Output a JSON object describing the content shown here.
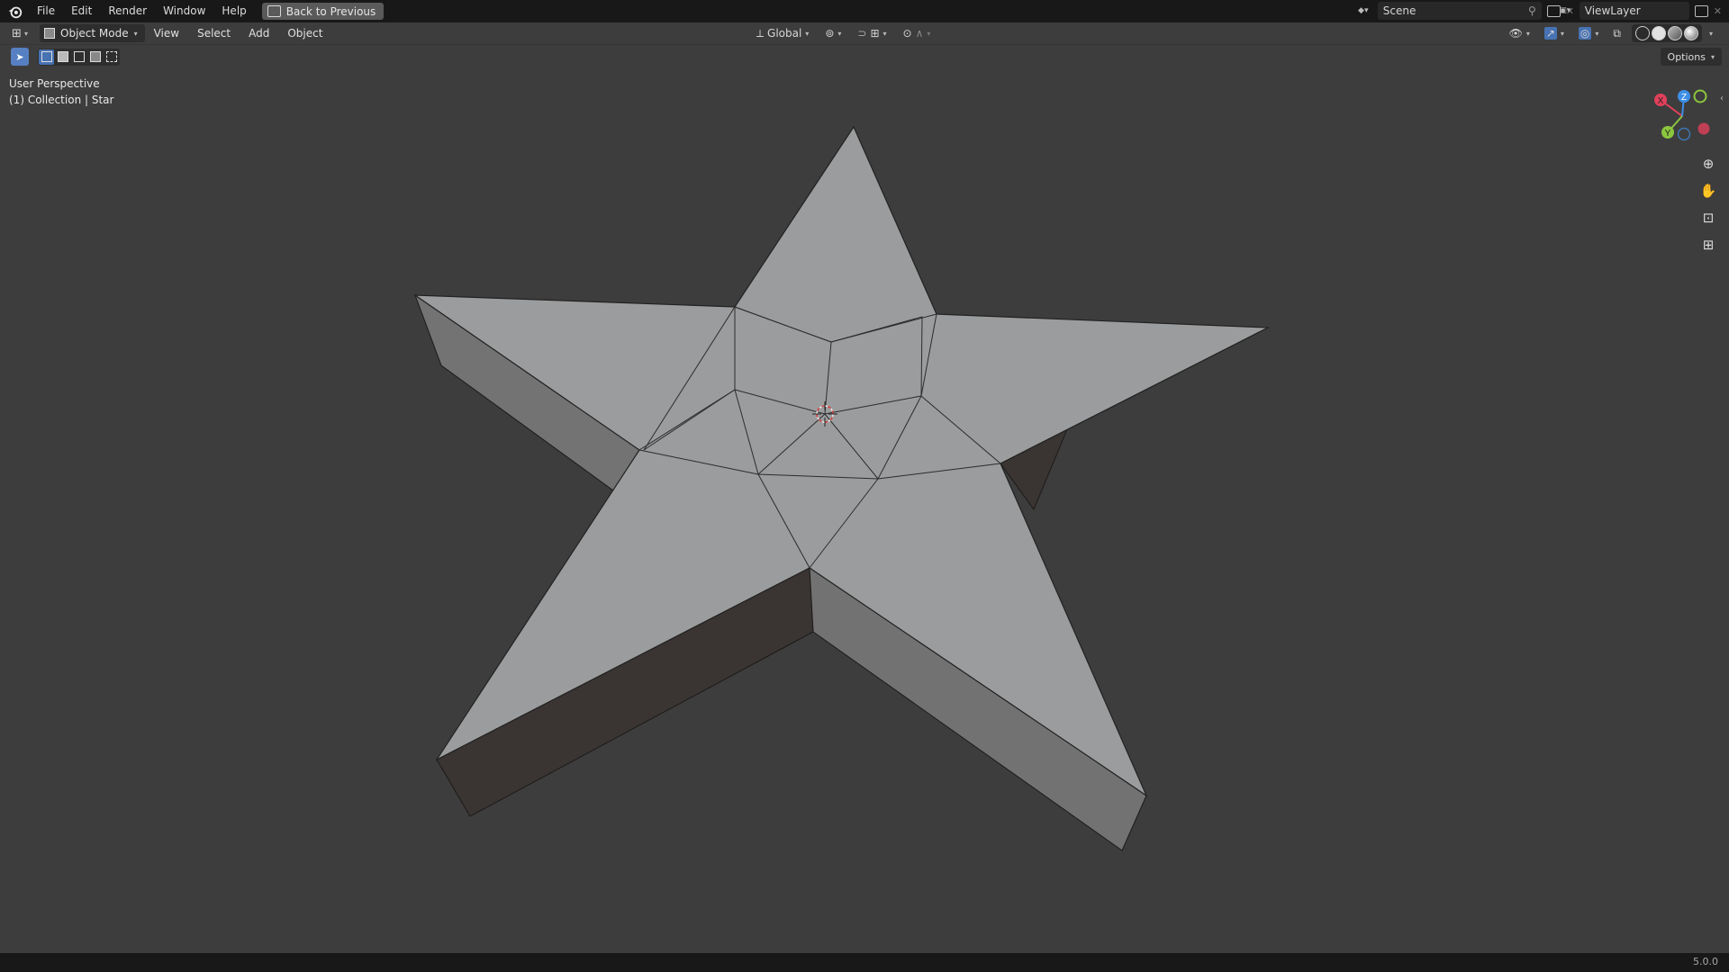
{
  "topbar": {
    "menus": [
      "File",
      "Edit",
      "Render",
      "Window",
      "Help"
    ],
    "back_label": "Back to Previous",
    "scene": "Scene",
    "view_layer": "ViewLayer"
  },
  "header": {
    "mode": "Object Mode",
    "menus": [
      "View",
      "Select",
      "Add",
      "Object"
    ],
    "transform_orientation": "Global",
    "options": "Options"
  },
  "viewport": {
    "perspective": "User Perspective",
    "collection": "(1) Collection | Star",
    "object": "Star"
  },
  "gizmo": {
    "x_label": "X",
    "y_label": "Y",
    "z_label": "Z",
    "x_color": "#e0405a",
    "y_color": "#8cc63e",
    "z_color": "#3d8fe6"
  },
  "status": {
    "version": "5.0.0"
  }
}
